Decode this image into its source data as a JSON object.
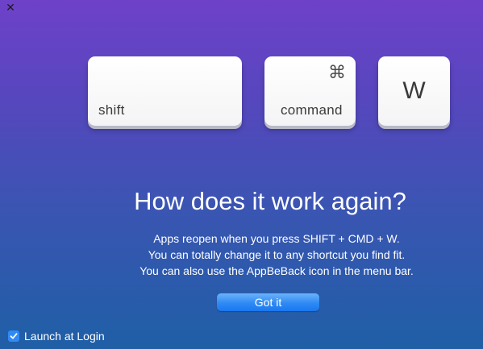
{
  "window": {
    "close_glyph": "✕"
  },
  "keys": {
    "shift": {
      "label": "shift"
    },
    "command": {
      "label": "command",
      "glyph": "⌘"
    },
    "w": {
      "label": "W"
    }
  },
  "headline": "How does it work again?",
  "description": [
    "Apps reopen when you press SHIFT + CMD + W.",
    "You can totally change it to any shortcut you find fit.",
    "You can also use the AppBeBack icon in the menu bar."
  ],
  "got_it_label": "Got it",
  "launch_at_login": {
    "label": "Launch at Login",
    "checked": true
  },
  "colors": {
    "background_top": "#6e41c9",
    "background_bottom": "#1f5fa6",
    "accent_button": "#2f8af5"
  }
}
